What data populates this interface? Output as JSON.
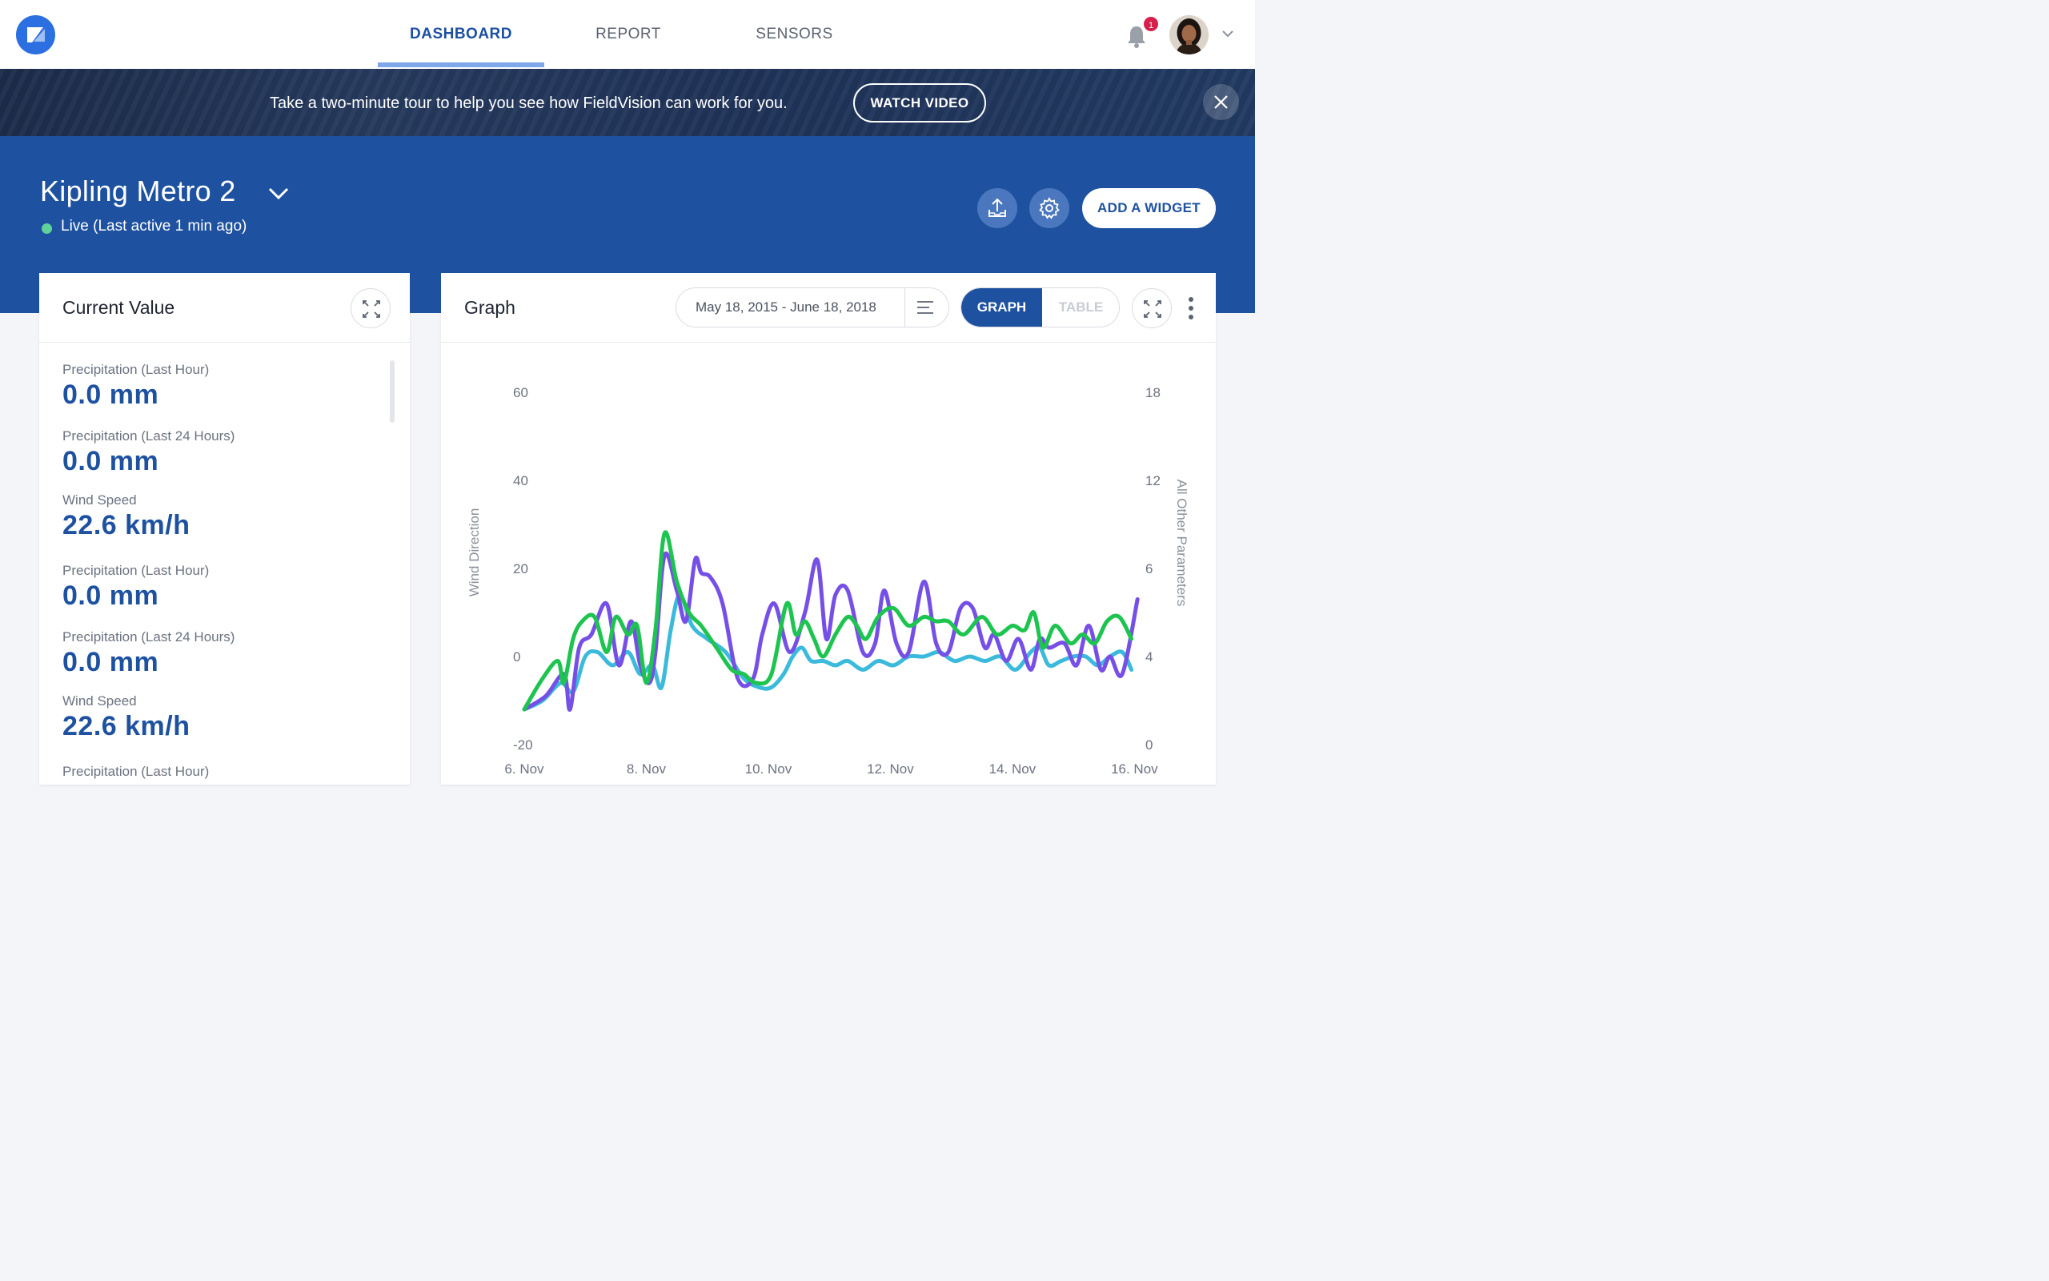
{
  "nav": {
    "tabs": [
      {
        "label": "DASHBOARD",
        "active": true
      },
      {
        "label": "REPORT",
        "active": false
      },
      {
        "label": "SENSORS",
        "active": false
      }
    ],
    "notification_count": "1"
  },
  "banner": {
    "text": "Take a two-minute tour to help you see how FieldVision can work for you.",
    "button_label": "WATCH VIDEO"
  },
  "header": {
    "site_name": "Kipling Metro 2",
    "status": "Live (Last active 1 min ago)",
    "add_widget_label": "ADD A WIDGET"
  },
  "current_value": {
    "title": "Current Value",
    "metrics": [
      {
        "label": "Precipitation (Last Hour)",
        "value": "0.0 mm"
      },
      {
        "label": "Precipitation (Last 24 Hours)",
        "value": "0.0 mm"
      },
      {
        "label": "Wind Speed",
        "value": "22.6 km/h"
      },
      {
        "label": "Precipitation (Last Hour)",
        "value": "0.0 mm"
      },
      {
        "label": "Precipitation (Last 24 Hours)",
        "value": "0.0 mm"
      },
      {
        "label": "Wind Speed",
        "value": "22.6 km/h"
      },
      {
        "label": "Precipitation (Last Hour)",
        "value": ""
      }
    ]
  },
  "graph": {
    "title": "Graph",
    "date_range": "May 18, 2015 - June 18, 2018",
    "toggle_graph": "GRAPH",
    "toggle_table": "TABLE"
  },
  "colors": {
    "brand_blue": "#1e52a0",
    "series_purple": "#7650e6",
    "series_green": "#1dc44f",
    "series_cyan": "#3bbadb",
    "live_green": "#60d39a"
  },
  "chart_data": {
    "type": "line",
    "xlabel": "",
    "ylabel": "Wind Direction",
    "y2label": "All Other Parameters",
    "x_ticks": [
      "6. Nov",
      "8. Nov",
      "10. Nov",
      "12. Nov",
      "14. Nov",
      "16. Nov"
    ],
    "x_range": [
      6,
      16.1
    ],
    "ylim": [
      -20,
      60
    ],
    "y_ticks": [
      -20,
      0,
      20,
      40,
      60
    ],
    "y2lim": [
      0,
      18
    ],
    "y2_ticks": [
      0,
      4,
      6,
      12,
      18
    ],
    "grid": false,
    "series": [
      {
        "color": "#7650e6",
        "x": [
          6.0,
          6.35,
          6.65,
          6.75,
          6.9,
          7.1,
          7.35,
          7.55,
          7.75,
          7.9,
          8.05,
          8.15,
          8.3,
          8.5,
          8.65,
          8.8,
          8.9,
          9.05,
          9.25,
          9.5,
          9.75,
          9.9,
          10.1,
          10.35,
          10.6,
          10.8,
          10.95,
          11.1,
          11.3,
          11.55,
          11.75,
          11.9,
          12.1,
          12.3,
          12.55,
          12.75,
          12.95,
          13.15,
          13.35,
          13.55,
          13.7,
          13.9,
          14.1,
          14.3,
          14.45,
          14.6,
          14.85,
          15.05,
          15.25,
          15.45,
          15.6,
          15.8,
          16.05
        ],
        "y": [
          -12,
          -9,
          -4,
          -12,
          2,
          5,
          12,
          -2,
          8,
          -2,
          -6,
          1,
          23,
          15,
          8,
          22,
          19,
          18,
          12,
          -5,
          -5,
          5,
          12,
          1,
          10,
          22,
          4,
          14,
          15,
          1,
          3,
          15,
          3,
          1,
          17,
          3,
          1,
          11,
          11,
          2,
          5,
          -1,
          4,
          -3,
          4,
          2,
          3,
          -2,
          7,
          -3,
          0,
          -4,
          13
        ]
      },
      {
        "color": "#1dc44f",
        "x": [
          6.0,
          6.3,
          6.55,
          6.65,
          6.8,
          6.95,
          7.15,
          7.35,
          7.5,
          7.7,
          7.85,
          8.0,
          8.15,
          8.3,
          8.5,
          8.7,
          8.9,
          9.15,
          9.4,
          9.6,
          9.8,
          10.05,
          10.3,
          10.45,
          10.6,
          10.75,
          10.9,
          11.1,
          11.3,
          11.45,
          11.6,
          11.8,
          12.05,
          12.3,
          12.55,
          12.75,
          12.95,
          13.2,
          13.5,
          13.75,
          14.0,
          14.2,
          14.35,
          14.5,
          14.7,
          14.95,
          15.15,
          15.35,
          15.55,
          15.75,
          15.95
        ],
        "y": [
          -12,
          -5,
          -1,
          -6,
          4,
          8,
          9,
          1,
          9,
          5,
          7,
          -6,
          6,
          28,
          17,
          10,
          7,
          2,
          -3,
          -4,
          -6,
          -4,
          12,
          5,
          8,
          4,
          0,
          5,
          9,
          7,
          4,
          9,
          11,
          7,
          9,
          8,
          8,
          5,
          9,
          5,
          7,
          6,
          10,
          2,
          7,
          3,
          5,
          3,
          8,
          9,
          4
        ]
      },
      {
        "color": "#3bbadb",
        "x": [
          6.0,
          6.3,
          6.6,
          6.8,
          7.0,
          7.2,
          7.45,
          7.7,
          7.9,
          8.1,
          8.25,
          8.4,
          8.55,
          8.75,
          9.0,
          9.3,
          9.6,
          9.85,
          10.05,
          10.25,
          10.4,
          10.55,
          10.7,
          10.9,
          11.1,
          11.3,
          11.55,
          11.8,
          12.05,
          12.3,
          12.55,
          12.8,
          13.05,
          13.3,
          13.55,
          13.8,
          14.05,
          14.3,
          14.45,
          14.6,
          14.8,
          15.0,
          15.2,
          15.4,
          15.6,
          15.8,
          15.95
        ],
        "y": [
          -12,
          -10,
          -6,
          -8,
          0,
          1,
          -2,
          1,
          -4,
          -2,
          -7,
          6,
          14,
          7,
          4,
          1,
          -5,
          -7,
          -7,
          -4,
          0,
          2,
          -1,
          -1,
          -2,
          -1,
          -3,
          -1,
          -2,
          0,
          0,
          1,
          -1,
          0,
          -1,
          0,
          -3,
          1,
          2,
          -2,
          -1,
          0,
          0,
          -2,
          0,
          1,
          -3
        ]
      }
    ]
  }
}
